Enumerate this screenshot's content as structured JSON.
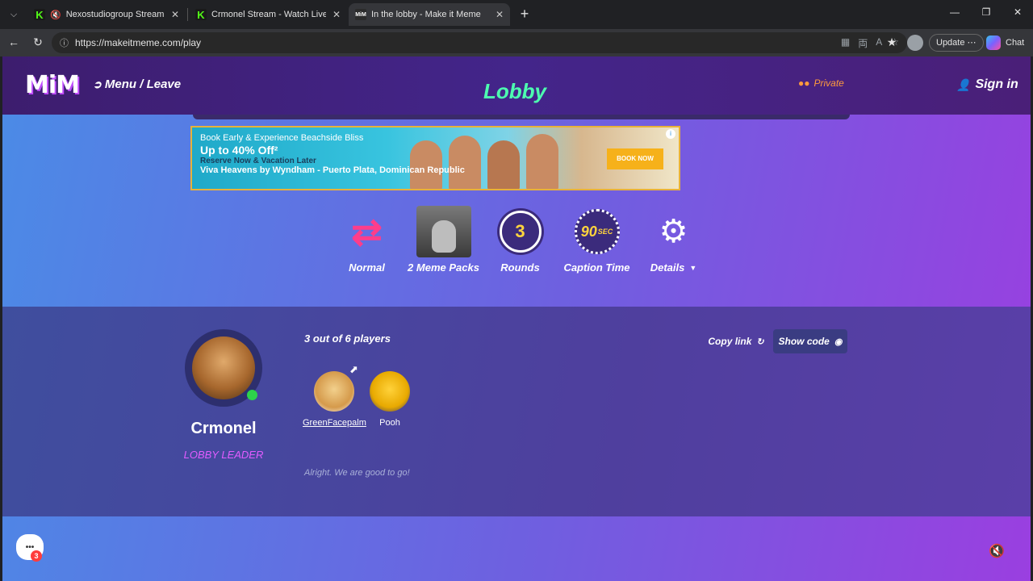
{
  "browser": {
    "tabs": [
      {
        "title": "Nexostudiogroup Stream - Wi",
        "favicon": "K",
        "muted": true,
        "active": false
      },
      {
        "title": "Crmonel Stream - Watch Live on K",
        "favicon": "K",
        "muted": false,
        "active": false
      },
      {
        "title": "In the lobby - Make it Meme",
        "favicon": "MiM",
        "muted": false,
        "active": true
      }
    ],
    "url": "https://makeitmeme.com/play",
    "update_label": "Update",
    "chat_label": "Chat"
  },
  "header": {
    "logo": "MiM",
    "menu_leave": "Menu / Leave",
    "title": "Lobby",
    "privacy": "Private",
    "sign_in": "Sign in"
  },
  "ad": {
    "line1": "Book Early & Experience Beachside Bliss",
    "line2": "Up to 40% Off²",
    "line3": "Reserve Now & Vacation Later",
    "line4": "Viva Heavens by Wyndham - Puerto Plata, Dominican Republic",
    "cta": "BOOK NOW",
    "info": "i"
  },
  "settings": {
    "mode": "Normal",
    "packs": "2 Meme Packs",
    "rounds_value": "3",
    "rounds_label": "Rounds",
    "caption_value": "90",
    "caption_unit": "SEC",
    "caption_label": "Caption Time",
    "details": "Details"
  },
  "lobby": {
    "leader": {
      "name": "Crmonel",
      "role": "LOBBY LEADER",
      "online": true
    },
    "players_count": "3 out of  6 players",
    "players": [
      {
        "name": "GreenFacepalm"
      },
      {
        "name": "Pooh"
      }
    ],
    "copy_link": "Copy link",
    "show_code": "Show code",
    "status": "Alright. We are good to go!"
  },
  "chat": {
    "badge": "3"
  },
  "colors": {
    "accent_green": "#4dffb0",
    "leader_role": "#e15cff",
    "private": "#ff9a3d",
    "rounds": "#ffd43d"
  }
}
